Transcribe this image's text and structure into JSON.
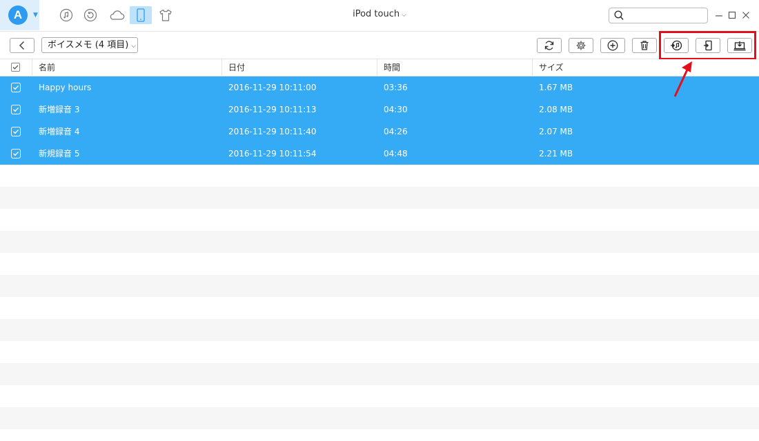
{
  "app": {
    "logo_letter": "A",
    "title": "iPod touch",
    "search_placeholder": ""
  },
  "nav_icons": [
    {
      "name": "music-icon"
    },
    {
      "name": "history-icon"
    },
    {
      "name": "cloud-icon"
    },
    {
      "name": "device-icon",
      "active": true
    },
    {
      "name": "tshirt-icon"
    }
  ],
  "toolbar": {
    "category_label": "ボイスメモ (4 項目)",
    "buttons": [
      {
        "name": "refresh-button"
      },
      {
        "name": "settings-button"
      },
      {
        "name": "add-button"
      },
      {
        "name": "delete-button"
      },
      {
        "name": "to-itunes-button"
      },
      {
        "name": "to-device-button"
      },
      {
        "name": "to-computer-button"
      }
    ]
  },
  "table": {
    "columns": [
      "名前",
      "日付",
      "時間",
      "サイズ"
    ],
    "rows": [
      {
        "name": "Happy hours",
        "date": "2016-11-29 10:11:00",
        "time": "03:36",
        "size": "1.67 MB"
      },
      {
        "name": "新増録音 3",
        "date": "2016-11-29 10:11:13",
        "time": "04:30",
        "size": "2.08 MB"
      },
      {
        "name": "新増録音 4",
        "date": "2016-11-29 10:11:40",
        "time": "04:26",
        "size": "2.07 MB"
      },
      {
        "name": "新規録音 5",
        "date": "2016-11-29 10:11:54",
        "time": "04:48",
        "size": "2.21 MB"
      }
    ]
  },
  "colors": {
    "accent": "#2e9bf0",
    "selected_row": "#35abf6",
    "highlight": "#e2101a"
  }
}
